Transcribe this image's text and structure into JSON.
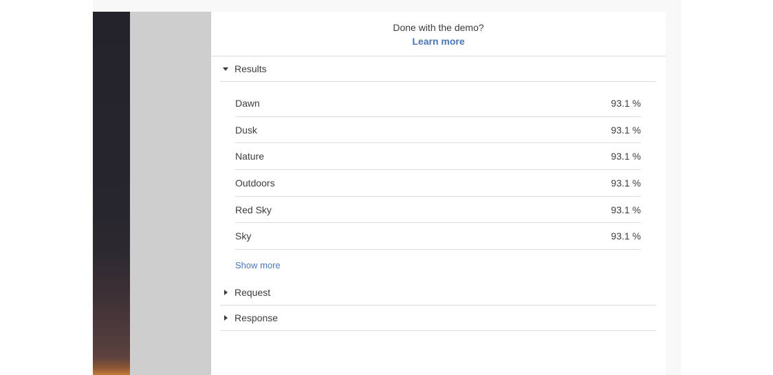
{
  "demo": {
    "prompt": "Done with the demo?",
    "learn_more": "Learn more"
  },
  "results": {
    "label": "Results",
    "expanded": true,
    "items": [
      {
        "label": "Dawn",
        "value": "93.1 %"
      },
      {
        "label": "Dusk",
        "value": "93.1 %"
      },
      {
        "label": "Nature",
        "value": "93.1 %"
      },
      {
        "label": "Outdoors",
        "value": "93.1 %"
      },
      {
        "label": "Red Sky",
        "value": "93.1 %"
      },
      {
        "label": "Sky",
        "value": "93.1 %"
      }
    ],
    "show_more": "Show more"
  },
  "request": {
    "label": "Request",
    "expanded": false
  },
  "response": {
    "label": "Response",
    "expanded": false
  },
  "colors": {
    "link": "#4a76b8",
    "divider": "#dcdcdc",
    "sidebar_gray": "#cecece"
  }
}
